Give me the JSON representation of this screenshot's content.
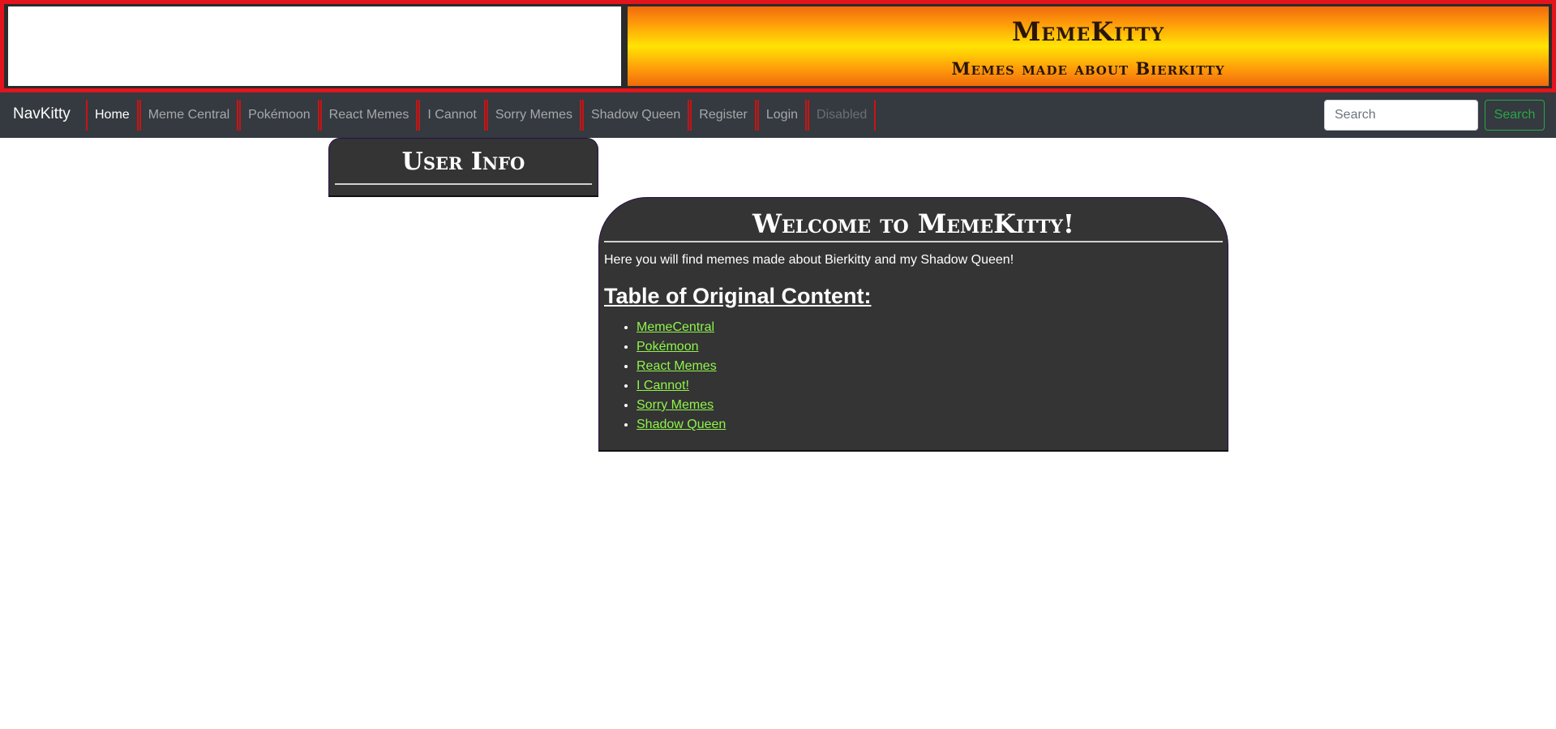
{
  "header": {
    "title": "MemeKitty",
    "subtitle": "Memes made about Bierkitty"
  },
  "navbar": {
    "brand": "NavKitty",
    "items": [
      {
        "label": "Home",
        "state": "active"
      },
      {
        "label": "Meme Central",
        "state": "normal"
      },
      {
        "label": "Pokémoon",
        "state": "normal"
      },
      {
        "label": "React Memes",
        "state": "normal"
      },
      {
        "label": "I Cannot",
        "state": "normal"
      },
      {
        "label": "Sorry Memes",
        "state": "normal"
      },
      {
        "label": "Shadow Queen",
        "state": "normal"
      },
      {
        "label": "Register",
        "state": "normal"
      },
      {
        "label": "Login",
        "state": "normal"
      },
      {
        "label": "Disabled",
        "state": "disabled"
      }
    ],
    "search_placeholder": "Search",
    "search_button": "Search"
  },
  "user_info": {
    "title": "User Info"
  },
  "welcome": {
    "title": "Welcome to MemeKitty!",
    "intro": "Here you will find memes made about Bierkitty and my Shadow Queen!",
    "toc_heading": "Table of Original Content:",
    "toc_links": [
      "MemeCentral",
      "Pokémoon",
      "React Memes",
      "I Cannot!",
      "Sorry Memes",
      "Shadow Queen"
    ]
  },
  "colors": {
    "header_border": "#e3141b",
    "nav_background": "#343a40",
    "nav_separator": "#c81414",
    "panel_background": "#343434",
    "link_color": "#8ef54a",
    "search_button": "#28a745"
  }
}
